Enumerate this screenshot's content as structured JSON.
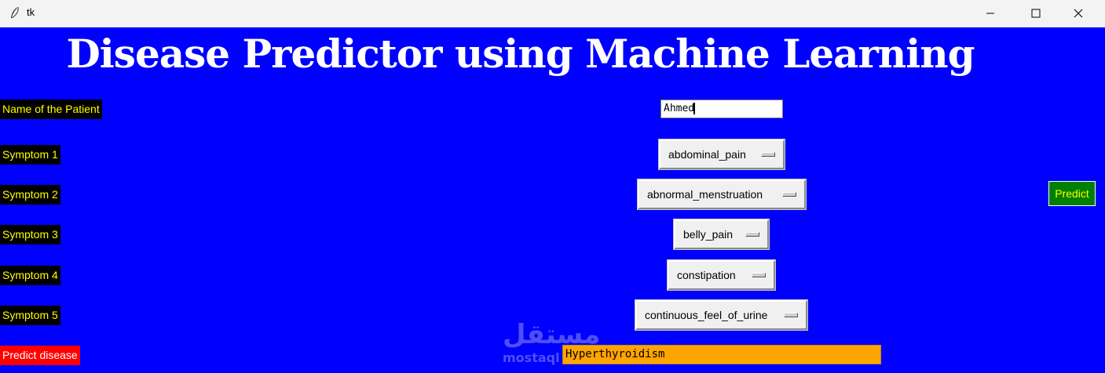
{
  "window": {
    "title": "tk",
    "icon": "feather-icon",
    "controls": [
      "minimize-icon",
      "maximize-icon",
      "close-icon"
    ]
  },
  "app": {
    "heading": "Disease Predictor using Machine Learning",
    "labels": {
      "name": "Name of the Patient",
      "symptom1": "Symptom 1",
      "symptom2": "Symptom 2",
      "symptom3": "Symptom 3",
      "symptom4": "Symptom 4",
      "symptom5": "Symptom 5",
      "predict_disease": "Predict disease"
    },
    "patient_name_value": "Ahmed",
    "symptoms": [
      "abdominal_pain",
      "abnormal_menstruation",
      "belly_pain",
      "constipation",
      "continuous_feel_of_urine"
    ],
    "predict_button_label": "Predict",
    "result": "Hyperthyroidism"
  },
  "watermark": {
    "arabic": "مستقل",
    "latin": "mostaql"
  },
  "colors": {
    "background": "#0000ff",
    "label_bg": "#000000",
    "label_text": "#ffff00",
    "predict_label_bg": "#ff0000",
    "predict_button_bg": "#008000",
    "result_bg": "#ffa500"
  }
}
